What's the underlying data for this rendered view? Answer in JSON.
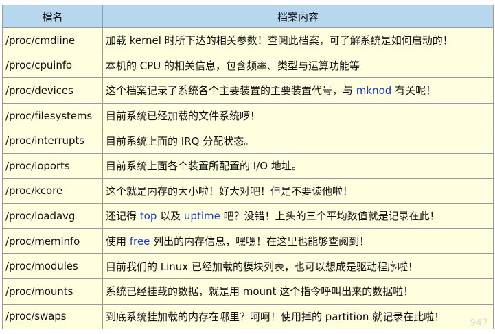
{
  "header": {
    "col1": "檔名",
    "col2": "档案内容"
  },
  "rows": [
    {
      "file": "/proc/cmdline",
      "desc": [
        {
          "t": "加载 kernel 时所下达的相关参数！查阅此档案，可了解系统是如何启动的！"
        }
      ]
    },
    {
      "file": "/proc/cpuinfo",
      "desc": [
        {
          "t": "本机的 CPU 的相关信息，包含频率、类型与运算功能等"
        }
      ]
    },
    {
      "file": "/proc/devices",
      "desc": [
        {
          "t": "这个档案记录了系统各个主要装置的主要装置代号，与 "
        },
        {
          "t": "mknod",
          "cmd": true
        },
        {
          "t": " 有关呢！"
        }
      ]
    },
    {
      "file": "/proc/filesystems",
      "desc": [
        {
          "t": "目前系统已经加载的文件系统啰！"
        }
      ]
    },
    {
      "file": "/proc/interrupts",
      "desc": [
        {
          "t": "目前系统上面的 IRQ 分配状态。"
        }
      ]
    },
    {
      "file": "/proc/ioports",
      "desc": [
        {
          "t": "目前系统上面各个装置所配置的 I/O 地址。"
        }
      ]
    },
    {
      "file": "/proc/kcore",
      "desc": [
        {
          "t": "这个就是内存的大小啦！好大对吧！但是不要读他啦！"
        }
      ]
    },
    {
      "file": "/proc/loadavg",
      "desc": [
        {
          "t": "还记得 "
        },
        {
          "t": "top",
          "cmd": true
        },
        {
          "t": " 以及 "
        },
        {
          "t": "uptime",
          "cmd": true
        },
        {
          "t": " 吧？没错！上头的三个平均数值就是记录在此！"
        }
      ]
    },
    {
      "file": "/proc/meminfo",
      "desc": [
        {
          "t": "使用 "
        },
        {
          "t": "free",
          "cmd": true
        },
        {
          "t": " 列出的内存信息，嘿嘿！在这里也能够查阅到！"
        }
      ]
    },
    {
      "file": "/proc/modules",
      "desc": [
        {
          "t": "目前我们的 Linux 已经加载的模块列表，也可以想成是驱动程序啦！"
        }
      ]
    },
    {
      "file": "/proc/mounts",
      "desc": [
        {
          "t": "系统已经挂载的数据，就是用 mount 这个指令呼叫出来的数据啦！"
        }
      ]
    },
    {
      "file": "/proc/swaps",
      "desc": [
        {
          "t": "到底系统挂加载的内存在哪里？呵呵！使用掉的 partition 就记录在此啦！"
        }
      ]
    }
  ],
  "watermark": "947",
  "colors": {
    "header_bg": "#b6d7ee",
    "cell_bg": "#ffffe0",
    "command_text": "#1a3cd0",
    "border": "#9a9a9a"
  }
}
